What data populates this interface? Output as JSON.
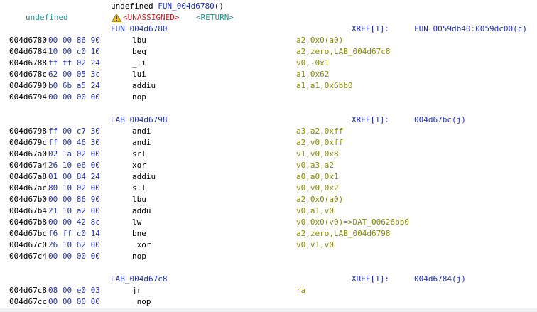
{
  "header": {
    "signature_prefix": "undefined ",
    "signature_name": "FUN_004d6780",
    "signature_suffix": "()",
    "return_type": "undefined",
    "unassigned": "<UNASSIGNED>",
    "return_label": "<RETURN>"
  },
  "blocks": [
    {
      "label": "FUN_004d6780",
      "xref_label": "XREF[1]:",
      "xref_value": "FUN_0059db40:0059dc00(c)",
      "rows": [
        {
          "addr": "004d6780",
          "bytes": "00 00 86 90",
          "mnemonic": "lbu",
          "operands": "a2,0x0(a0)"
        },
        {
          "addr": "004d6784",
          "bytes": "10 00 c0 10",
          "mnemonic": "beq",
          "operands": "a2,zero,LAB_004d67c8"
        },
        {
          "addr": "004d6788",
          "bytes": "ff ff 02 24",
          "mnemonic": "_li",
          "operands": "v0,-0x1"
        },
        {
          "addr": "004d678c",
          "bytes": "62 00 05 3c",
          "mnemonic": "lui",
          "operands": "a1,0x62"
        },
        {
          "addr": "004d6790",
          "bytes": "b0 6b a5 24",
          "mnemonic": "addiu",
          "operands": "a1,a1,0x6bb0"
        },
        {
          "addr": "004d6794",
          "bytes": "00 00 00 00",
          "mnemonic": "nop",
          "operands": ""
        }
      ]
    },
    {
      "label": "LAB_004d6798",
      "xref_label": "XREF[1]:",
      "xref_value": "004d67bc(j)",
      "rows": [
        {
          "addr": "004d6798",
          "bytes": "ff 00 c7 30",
          "mnemonic": "andi",
          "operands": "a3,a2,0xff"
        },
        {
          "addr": "004d679c",
          "bytes": "ff 00 46 30",
          "mnemonic": "andi",
          "operands": "a2,v0,0xff"
        },
        {
          "addr": "004d67a0",
          "bytes": "02 1a 02 00",
          "mnemonic": "srl",
          "operands": "v1,v0,0x8"
        },
        {
          "addr": "004d67a4",
          "bytes": "26 10 e6 00",
          "mnemonic": "xor",
          "operands": "v0,a3,a2"
        },
        {
          "addr": "004d67a8",
          "bytes": "01 00 84 24",
          "mnemonic": "addiu",
          "operands": "a0,a0,0x1"
        },
        {
          "addr": "004d67ac",
          "bytes": "80 10 02 00",
          "mnemonic": "sll",
          "operands": "v0,v0,0x2"
        },
        {
          "addr": "004d67b0",
          "bytes": "00 00 86 90",
          "mnemonic": "lbu",
          "operands": "a2,0x0(a0)"
        },
        {
          "addr": "004d67b4",
          "bytes": "21 10 a2 00",
          "mnemonic": "addu",
          "operands": "v0,a1,v0"
        },
        {
          "addr": "004d67b8",
          "bytes": "00 00 42 8c",
          "mnemonic": "lw",
          "operands": "v0,0x0(v0)=>DAT_00626bb0"
        },
        {
          "addr": "004d67bc",
          "bytes": "f6 ff c0 14",
          "mnemonic": "bne",
          "operands": "a2,zero,LAB_004d6798"
        },
        {
          "addr": "004d67c0",
          "bytes": "26 10 62 00",
          "mnemonic": "_xor",
          "operands": "v0,v1,v0"
        },
        {
          "addr": "004d67c4",
          "bytes": "00 00 00 00",
          "mnemonic": "nop",
          "operands": ""
        }
      ]
    },
    {
      "label": "LAB_004d67c8",
      "xref_label": "XREF[1]:",
      "xref_value": "004d6784(j)",
      "rows": [
        {
          "addr": "004d67c8",
          "bytes": "08 00 e0 03",
          "mnemonic": "jr",
          "operands": "ra"
        },
        {
          "addr": "004d67cc",
          "bytes": "00 00 00 00",
          "mnemonic": "_nop",
          "operands": ""
        }
      ]
    }
  ],
  "colors": {
    "address": "#000000",
    "bytes": "#1d2ec5",
    "operands": "#868a00",
    "warning": "#e3121a",
    "return": "#1f8f8f"
  },
  "icons": {
    "warning": "warning-triangle-icon"
  }
}
